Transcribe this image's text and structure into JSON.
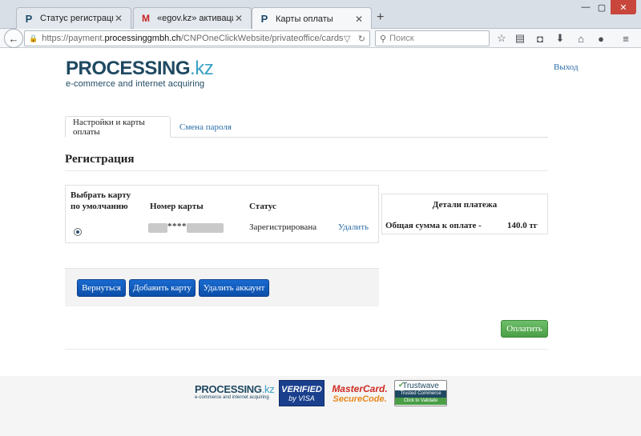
{
  "browser": {
    "tabs": [
      {
        "label": "Статус регистрации",
        "favicon": "P",
        "active": false
      },
      {
        "label": "«egov.kz» активация акка...",
        "favicon": "M",
        "active": false
      },
      {
        "label": "Карты оплаты",
        "favicon": "P",
        "active": true
      }
    ],
    "url_prefix": "https://payment.",
    "url_domain": "processinggmbh.ch",
    "url_path": "/CNPOneClickWebsite/privateoffice/cards",
    "search_placeholder": "Поиск",
    "icons": [
      "star-icon",
      "reading-list-icon",
      "pocket-icon",
      "download-icon",
      "home-icon",
      "chat-icon",
      "menu-icon"
    ]
  },
  "header": {
    "logo_main": "PROCESSING",
    "logo_kz": ".kz",
    "logo_sub": "e-commerce and internet acquiring",
    "logout": "Выход"
  },
  "tabs": {
    "settings": "Настройки и карты оплаты",
    "password": "Смена пароля"
  },
  "section": {
    "title": "Регистрация"
  },
  "cards": {
    "col_default_1": "Выбрать карту",
    "col_default_2": "по умолчанию",
    "col_number": "Номер карты",
    "col_status": "Статус",
    "card_masked": "****",
    "card_status": "Зарегистрирована",
    "delete": "Удалить",
    "default_selected": true
  },
  "details": {
    "title": "Детали платежа",
    "total_label": "Общая сумма к оплате -",
    "total_value": "140.0 тг"
  },
  "actions": {
    "back": "Вернуться",
    "add_card": "Добавить карту",
    "delete_account": "Удалить аккаунт",
    "pay": "Оплатить"
  },
  "footer": {
    "logo_main": "PROCESSING",
    "logo_kz": ".kz",
    "logo_sub": "e-commerce and internet acquiring",
    "vbv_1": "VERIFIED",
    "vbv_2": "by VISA",
    "mc_1": "MasterCard.",
    "mc_2": "SecureCode.",
    "tw_1": "Trustwave",
    "tw_2": "Trusted Commerce",
    "tw_3": "Click to Validate"
  },
  "colors": {
    "link": "#2a6da8",
    "primary_button": "#0b4ea8",
    "pay_button": "#4a9e45",
    "logo_dark": "#1f4961",
    "logo_accent": "#39a0c4"
  }
}
